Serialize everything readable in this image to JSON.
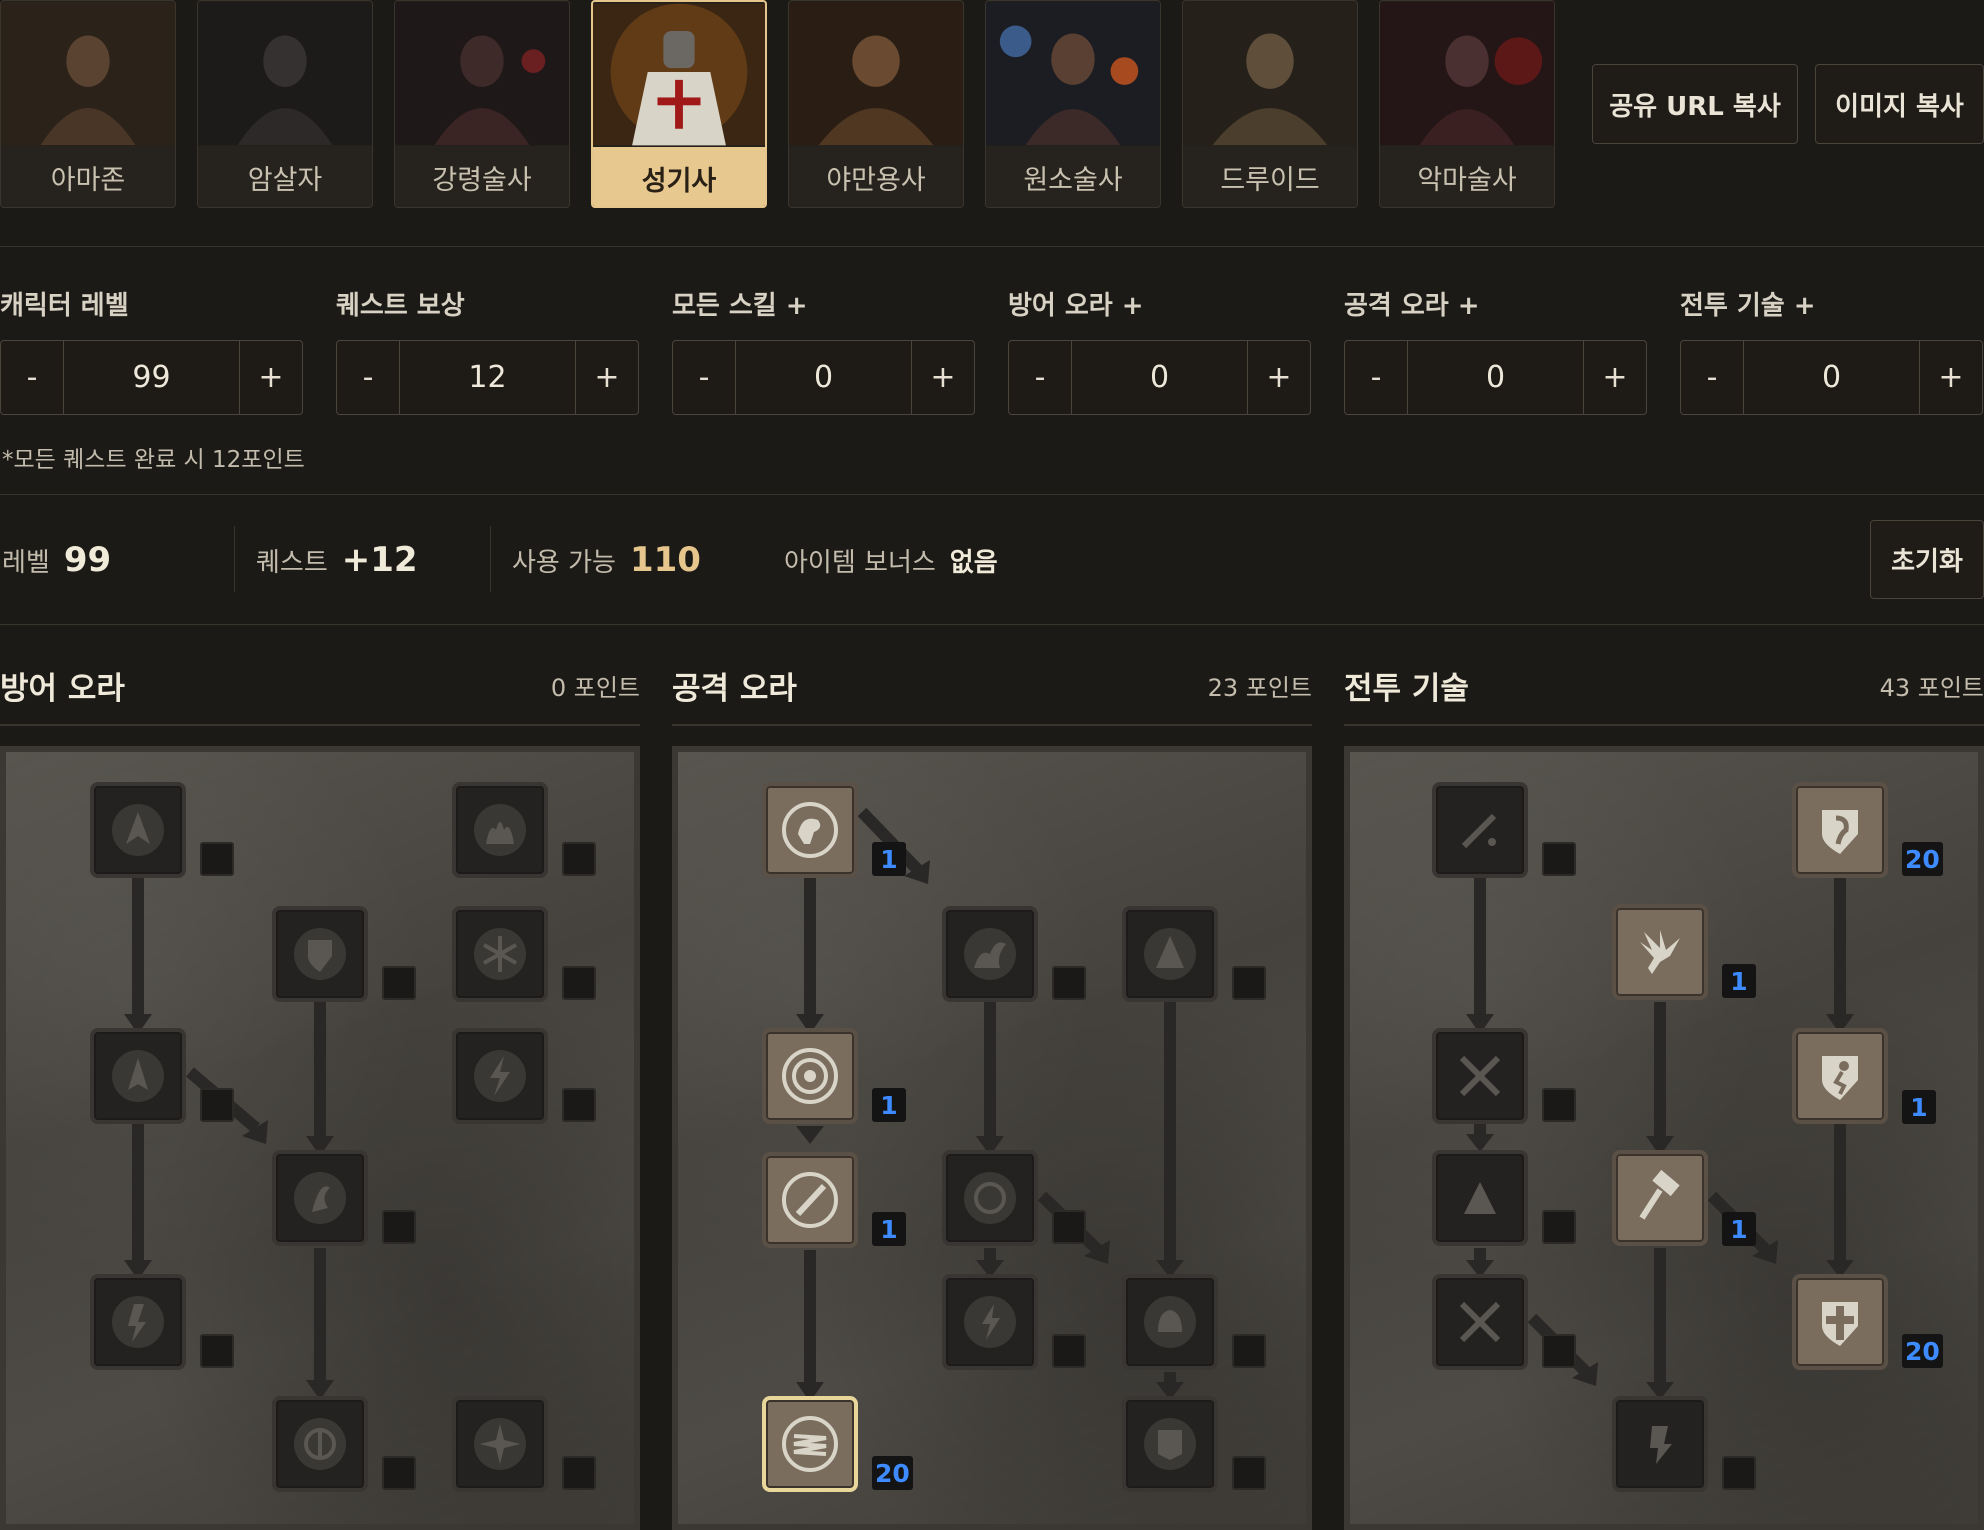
{
  "classes": [
    {
      "label": "아마존"
    },
    {
      "label": "암살자"
    },
    {
      "label": "강령술사"
    },
    {
      "label": "성기사",
      "active": true
    },
    {
      "label": "야만용사"
    },
    {
      "label": "원소술사"
    },
    {
      "label": "드루이드"
    },
    {
      "label": "악마술사"
    }
  ],
  "header_buttons": {
    "share_url": "공유 URL 복사",
    "copy_image": "이미지 복사"
  },
  "steppers": [
    {
      "label": "캐릭터 레벨",
      "value": "99"
    },
    {
      "label": "퀘스트 보상",
      "value": "12"
    },
    {
      "label": "모든 스킬 +",
      "value": "0"
    },
    {
      "label": "방어 오라 +",
      "value": "0"
    },
    {
      "label": "공격 오라 +",
      "value": "0"
    },
    {
      "label": "전투 기술 +",
      "value": "0"
    }
  ],
  "stepper_minus": "-",
  "stepper_plus": "+",
  "quest_note": "*모든 퀘스트 완료 시 12포인트",
  "summary": {
    "level_label": "레벨",
    "level_value": "99",
    "quest_label": "퀘스트",
    "quest_value": "+12",
    "available_label": "사용 가능",
    "available_value": "110",
    "item_label": "아이템 보너스",
    "item_value": "없음"
  },
  "reset_label": "초기화",
  "trees": [
    {
      "title": "방어 오라",
      "points": "0 포인트"
    },
    {
      "title": "공격 오라",
      "points": "23 포인트"
    },
    {
      "title": "전투 기술",
      "points": "43 포인트"
    }
  ],
  "skill_points": {
    "offense": [
      "1",
      "1",
      "1",
      "20"
    ],
    "combat": [
      "20",
      "1",
      "1",
      "1",
      "20"
    ]
  },
  "colors": {
    "accent": "#e7c98f",
    "points": "#3d8bff",
    "background": "#1c1a16"
  }
}
